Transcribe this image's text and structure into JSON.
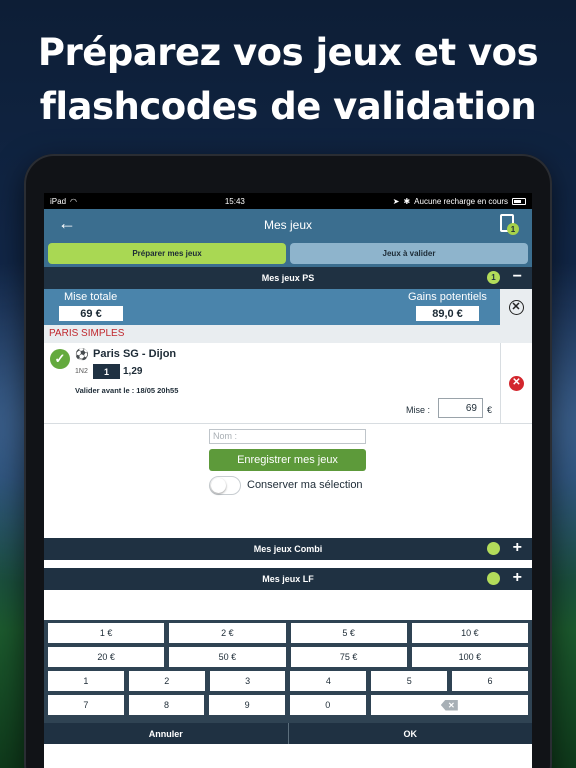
{
  "headline": {
    "line1": "Préparez vos jeux et vos",
    "line2": "flashcodes de validation"
  },
  "status_bar": {
    "device": "iPad",
    "time": "15:43",
    "right_text": "Aucune recharge en cours"
  },
  "nav": {
    "title": "Mes jeux",
    "back_icon": "arrow-left",
    "doc_badge": "1"
  },
  "tabs": [
    {
      "label": "Préparer mes jeux",
      "active": true
    },
    {
      "label": "Jeux à valider",
      "active": false
    }
  ],
  "section_ps": {
    "title": "Mes jeux PS",
    "count": "1",
    "toggle": "−"
  },
  "totals": {
    "mise_label": "Mise totale",
    "mise_value": "69 €",
    "gains_label": "Gains potentiels",
    "gains_value": "89,0 €"
  },
  "category": "PARIS SIMPLES",
  "bet": {
    "ball": "⚽",
    "match": "Paris SG - Dijon",
    "type": "1N2",
    "pick": "1",
    "odds": "1,29",
    "deadline": "Valider avant le : 18/05 20h55",
    "mise_label": "Mise :",
    "mise_value": "69",
    "currency": "€"
  },
  "form": {
    "name_placeholder": "Nom :",
    "register_label": "Enregistrer mes jeux",
    "keep_label": "Conserver ma sélection",
    "keep_on": false
  },
  "section_combi": {
    "title": "Mes jeux Combi",
    "toggle": "+"
  },
  "section_lf": {
    "title": "Mes jeux LF",
    "toggle": "+"
  },
  "keypad": {
    "amounts_row1": [
      "1 €",
      "2 €",
      "5 €",
      "10 €"
    ],
    "amounts_row2": [
      "20 €",
      "50 €",
      "75 €",
      "100 €"
    ],
    "digits_row1": [
      "1",
      "2",
      "3",
      "4",
      "5",
      "6"
    ],
    "digits_row2": [
      "7",
      "8",
      "9",
      "0"
    ],
    "backspace_icon": "backspace-icon",
    "cancel": "Annuler",
    "ok": "OK"
  },
  "colors": {
    "nav": "#3b6e8f",
    "dark": "#1f3142",
    "green_tab": "#a9d853",
    "green_button": "#5d9a3a",
    "red": "#d3262d",
    "category_red": "#c0272d"
  }
}
